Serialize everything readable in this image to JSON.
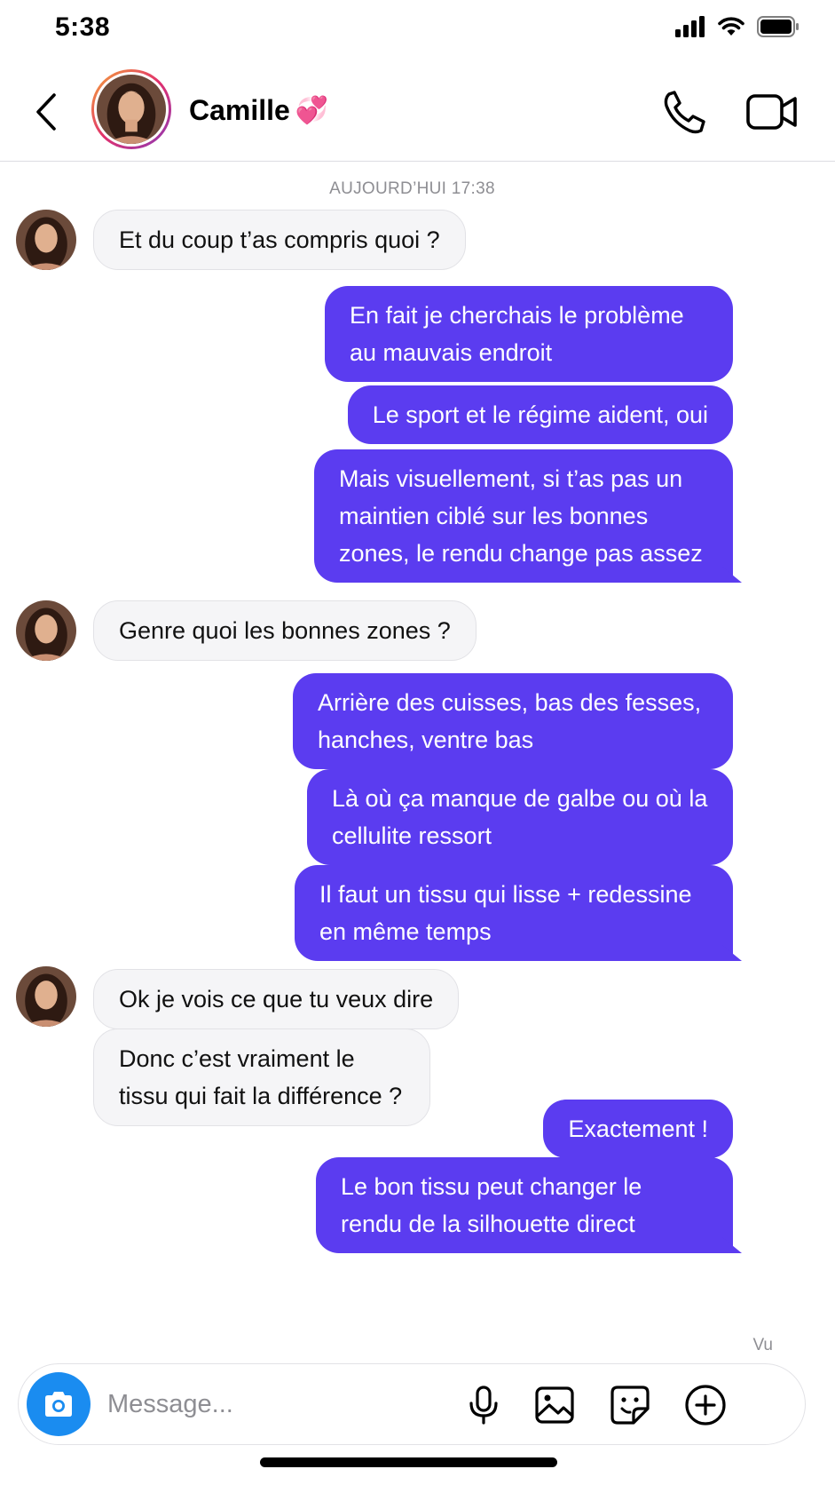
{
  "status_bar": {
    "time": "5:38"
  },
  "header": {
    "contact_name": "Camille",
    "name_emoji": "💞",
    "icons": [
      "back-icon",
      "phone-icon",
      "video-camera-icon"
    ]
  },
  "conversation": {
    "timestamp": "AUJOURD’HUI 17:38",
    "messages": [
      {
        "sender": "Camille",
        "text": "Et du coup t’as compris quoi ?"
      },
      {
        "sender": "me",
        "text": "En fait je cherchais le problème au mauvais endroit"
      },
      {
        "sender": "me",
        "text": "Le sport et le régime aident, oui"
      },
      {
        "sender": "me",
        "text": "Mais visuellement, si t’as pas un maintien ciblé sur les bonnes zones, le rendu change pas assez"
      },
      {
        "sender": "Camille",
        "text": "Genre quoi les bonnes zones ?"
      },
      {
        "sender": "me",
        "text": "Arrière des cuisses, bas des fesses, hanches, ventre bas"
      },
      {
        "sender": "me",
        "text": "Là où ça manque de galbe ou où la cellulite ressort"
      },
      {
        "sender": "me",
        "text": "Il faut un tissu qui lisse + redessine en même temps"
      },
      {
        "sender": "Camille",
        "text": "Ok je vois ce que tu veux dire"
      },
      {
        "sender": "Camille",
        "text": "Donc c’est vraiment le tissu qui fait la différence ?"
      },
      {
        "sender": "me",
        "text": "Exactement !"
      },
      {
        "sender": "me",
        "text": "Le bon tissu peut changer le rendu de la silhouette direct"
      }
    ],
    "seen_label": "Vu"
  },
  "composer": {
    "placeholder": "Message...",
    "icons": [
      "camera-icon",
      "microphone-icon",
      "gallery-icon",
      "sticker-icon",
      "add-icon"
    ]
  },
  "colors": {
    "outgoing_bubble": "#5b3cf0",
    "incoming_bubble": "#f5f5f7",
    "camera_button": "#1a8cf0"
  }
}
